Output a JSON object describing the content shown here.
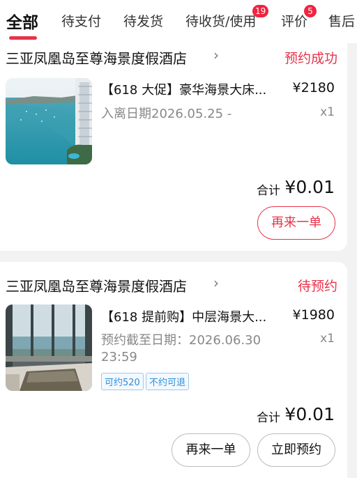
{
  "tabs": [
    {
      "label": "全部"
    },
    {
      "label": "待支付"
    },
    {
      "label": "待发货"
    },
    {
      "label": "待收货/使用",
      "badge": "19"
    },
    {
      "label": "评价",
      "badge": "5"
    },
    {
      "label": "售后"
    }
  ],
  "orders": [
    {
      "store": "三亚凤凰岛至尊海景度假酒店",
      "status": "预约成功",
      "title": "【618 大促】豪华海景大床...",
      "price": "¥2180",
      "date_line": "入离日期2026.05.25 -",
      "qty": "x1",
      "total_label": "合计",
      "total": "¥0.01",
      "buttons": [
        "再来一单"
      ]
    },
    {
      "store": "三亚凤凰岛至尊海景度假酒店",
      "status": "待预约",
      "title": "【618 提前购】中层海景大...",
      "price": "¥1980",
      "date_line": "预约截至日期：2026.06.30",
      "date_line2": "23:59",
      "qty": "x1",
      "tags": [
        "可约520",
        "不约可退"
      ],
      "total_label": "合计",
      "total": "¥0.01",
      "buttons": [
        "再来一单",
        "立即预约"
      ]
    }
  ],
  "colors": {
    "accent": "#e8334a",
    "badge": "#f0243f",
    "tag_blue": "#2b8fd9"
  }
}
